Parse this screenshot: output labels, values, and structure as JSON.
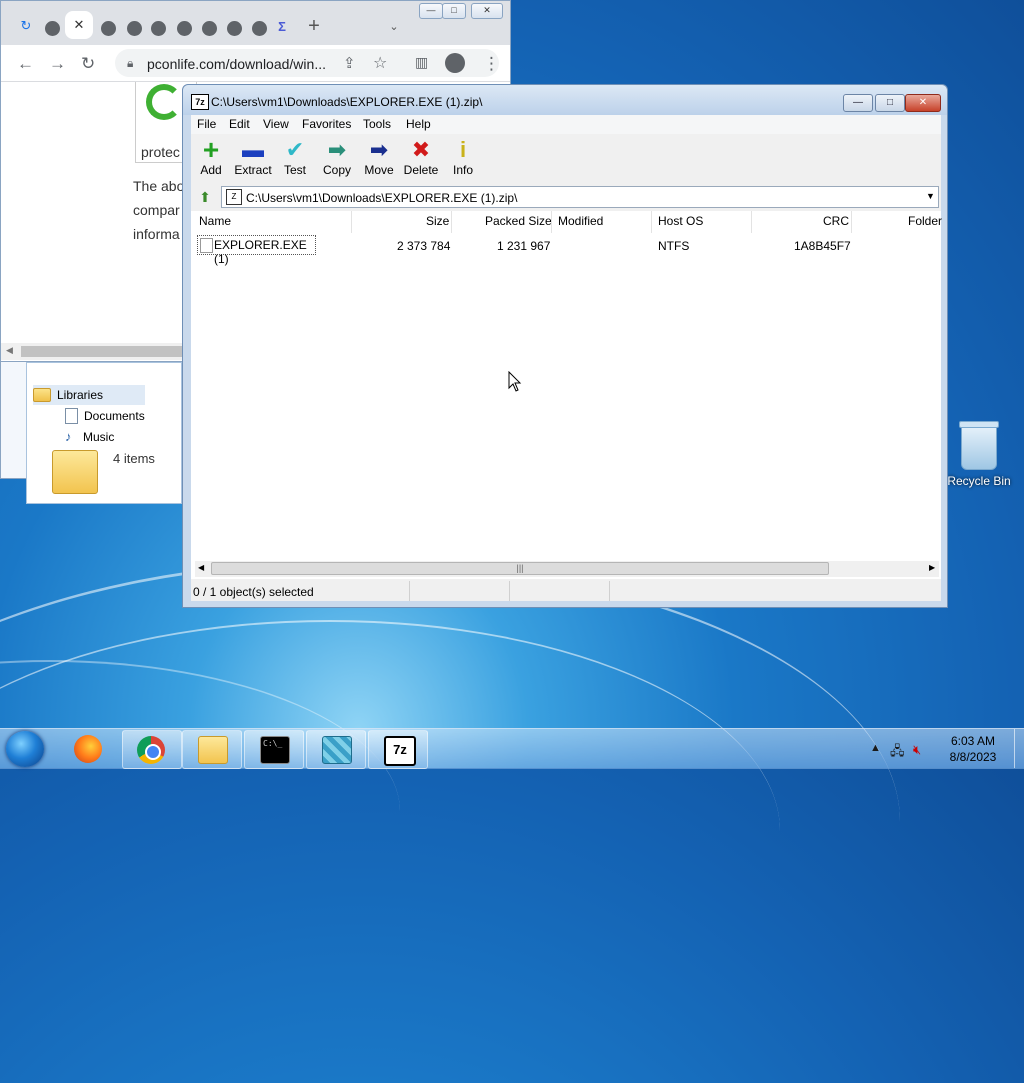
{
  "desktop": {
    "recycle_bin_label": "Recycle Bin"
  },
  "browser": {
    "url": "pconlife.com/download/win...",
    "page_lines": [
      "The abo",
      "compar",
      "informa"
    ],
    "caption_fragment": "protec"
  },
  "explorer": {
    "nav_items": [
      {
        "label": "Libraries",
        "icon": "folder-icon"
      },
      {
        "label": "Documents",
        "icon": "document-icon"
      },
      {
        "label": "Music",
        "icon": "music-icon"
      }
    ],
    "item_count": "4 items"
  },
  "zip": {
    "title": "C:\\Users\\vm1\\Downloads\\EXPLORER.EXE (1).zip\\",
    "menu": [
      "File",
      "Edit",
      "View",
      "Favorites",
      "Tools",
      "Help"
    ],
    "toolbar": [
      {
        "label": "Add",
        "icon": "plus-icon",
        "color": "#22a022"
      },
      {
        "label": "Extract",
        "icon": "minus-icon",
        "color": "#1b3fbf"
      },
      {
        "label": "Test",
        "icon": "check-icon",
        "color": "#2fb8c8"
      },
      {
        "label": "Copy",
        "icon": "arrow-right-icon",
        "color": "#2a8f7a"
      },
      {
        "label": "Move",
        "icon": "arrow-right-icon",
        "color": "#1a2f8f"
      },
      {
        "label": "Delete",
        "icon": "x-icon",
        "color": "#d11a1a"
      },
      {
        "label": "Info",
        "icon": "info-icon",
        "color": "#d8c21a"
      }
    ],
    "address": "C:\\Users\\vm1\\Downloads\\EXPLORER.EXE (1).zip\\",
    "columns": [
      "Name",
      "Size",
      "Packed Size",
      "Modified",
      "Host OS",
      "CRC",
      "Folder"
    ],
    "rows": [
      {
        "name": "EXPLORER.EXE (1)",
        "size": "2 373 784",
        "packed": "1 231 967",
        "modified": "",
        "host": "NTFS",
        "crc": "1A8B45F7"
      }
    ],
    "status": "0 / 1 object(s) selected"
  },
  "taskbar": {
    "apps": [
      "firefox-icon",
      "chrome-icon",
      "file-explorer-icon",
      "cmd-icon",
      "installer-icon",
      "7zip-icon"
    ],
    "time": "6:03 AM",
    "date": "8/8/2023"
  }
}
